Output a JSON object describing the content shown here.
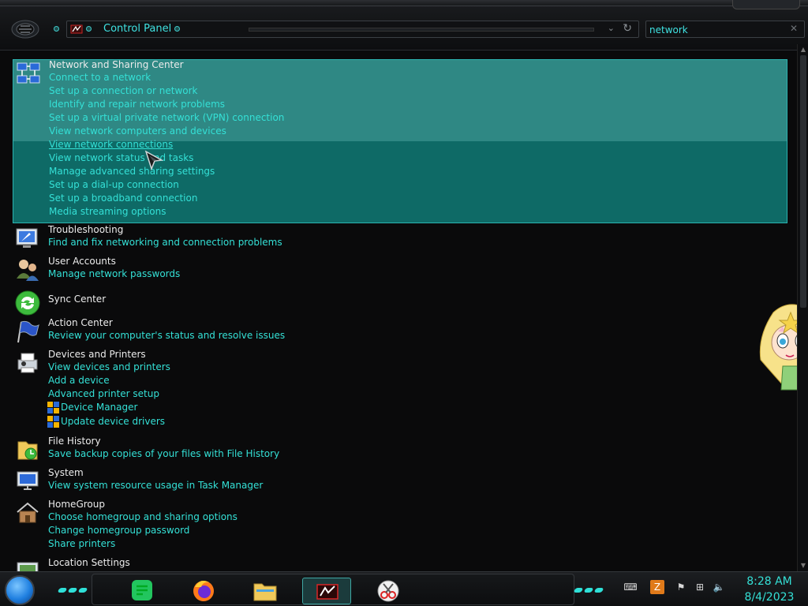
{
  "window": {
    "breadcrumb": "Control Panel",
    "search_value": "network",
    "clear_glyph": "✕",
    "dropdown_glyph": "⌄",
    "refresh_glyph": "↻"
  },
  "groups": [
    {
      "title": "Network and Sharing Center",
      "icon": "network-sharing-icon",
      "links": [
        "Connect to a network",
        "Set up a connection or network",
        "Identify and repair network problems",
        "Set up a virtual private network (VPN) connection",
        "View network computers and devices",
        "View network connections",
        "View network status and tasks",
        "Manage advanced sharing settings",
        "Set up a dial-up connection",
        "Set up a broadband connection",
        "Media streaming options"
      ]
    },
    {
      "title": "Troubleshooting",
      "icon": "troubleshooting-icon",
      "links": [
        "Find and fix networking and connection problems"
      ]
    },
    {
      "title": "User Accounts",
      "icon": "user-accounts-icon",
      "links": [
        "Manage network passwords"
      ]
    },
    {
      "title": "Sync Center",
      "icon": "sync-center-icon",
      "links": []
    },
    {
      "title": "Action Center",
      "icon": "action-center-flag-icon",
      "links": [
        "Review your computer's status and resolve issues"
      ]
    },
    {
      "title": "Devices and Printers",
      "icon": "devices-printers-icon",
      "links": [
        "View devices and printers",
        "Add a device",
        "Advanced printer setup"
      ],
      "shield_links": [
        "Device Manager",
        "Update device drivers"
      ]
    },
    {
      "title": "File History",
      "icon": "file-history-icon",
      "links": [
        "Save backup copies of your files with File History"
      ]
    },
    {
      "title": "System",
      "icon": "system-icon",
      "links": [
        "View system resource usage in Task Manager"
      ]
    },
    {
      "title": "HomeGroup",
      "icon": "homegroup-icon",
      "links": [
        "Choose homegroup and sharing options",
        "Change homegroup password",
        "Share printers"
      ]
    },
    {
      "title": "Location Settings",
      "icon": "location-settings-icon",
      "links": []
    }
  ],
  "taskbar": {
    "apps": [
      {
        "name": "notes-app",
        "icon": "notes-icon"
      },
      {
        "name": "firefox",
        "icon": "firefox-icon"
      },
      {
        "name": "file-explorer",
        "icon": "folder-icon"
      },
      {
        "name": "control-panel",
        "icon": "control-panel-icon",
        "active": true
      },
      {
        "name": "snipping-tool",
        "icon": "scissors-icon"
      }
    ],
    "tray": [
      "keyboard-icon",
      "app-tray-icon",
      "action-center-flag-icon",
      "network-icon",
      "volume-icon"
    ],
    "time": "8:28 AM",
    "date": "8/4/2023"
  },
  "colors": {
    "accent": "#34e0d6",
    "selection": "#0e6a66",
    "selection_highlight": "#2f8884",
    "background": "#0a0a0b"
  }
}
